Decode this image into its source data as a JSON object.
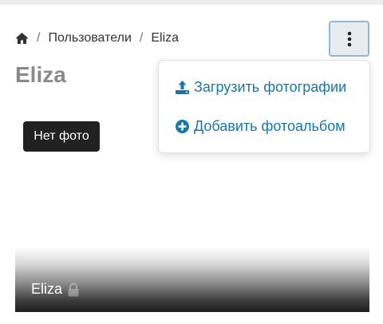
{
  "breadcrumb": {
    "home_icon": "home-icon",
    "users_label": "Пользователи",
    "current_label": "Eliza",
    "separator": "/"
  },
  "menu_button": {
    "icon": "vertical-dots-icon"
  },
  "page": {
    "title": "Eliza"
  },
  "no_photo": {
    "label": "Нет фото"
  },
  "dropdown": {
    "items": [
      {
        "label": "Загрузить фотографии",
        "icon": "upload-icon"
      },
      {
        "label": "Добавить фотоальбом",
        "icon": "plus-circle-icon"
      }
    ]
  },
  "album": {
    "name": "Eliza",
    "icon": "lock-icon"
  },
  "colors": {
    "link": "#1677a8",
    "title": "#8a8a8a",
    "badge_bg": "#212121",
    "menu_border": "#8fb8d8"
  }
}
